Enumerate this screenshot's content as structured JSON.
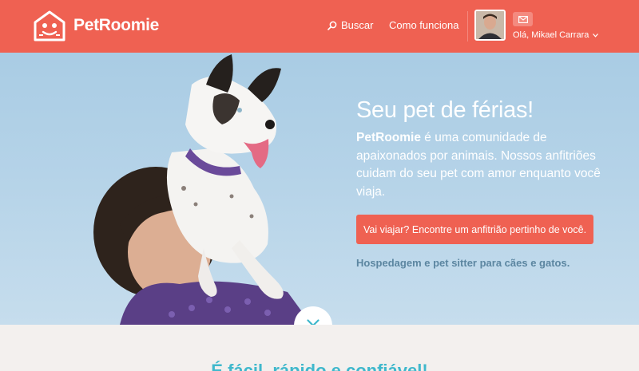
{
  "header": {
    "brand_name": "PetRoomie",
    "nav_search": "Buscar",
    "nav_how": "Como funciona",
    "greeting": "Olá, Mikael Carrara",
    "icons": [
      "logo-icon",
      "search-icon",
      "mail-icon",
      "chevron-down-icon",
      "avatar"
    ]
  },
  "hero": {
    "title": "Seu pet de férias!",
    "body_brand": "PetRoomie",
    "body_rest": " é uma comunidade de apaixonados por animais. Nossos anfitriões cuidam do seu pet com amor enquanto você viaja.",
    "cta_label": "Vai viajar? Encontre um anfitrião pertinho de você.",
    "tagline": "Hospedagem e pet sitter para cães e gatos."
  },
  "section": {
    "title": "É fácil, rápido e confiável!"
  },
  "colors": {
    "brand": "#ef6152",
    "teal": "#3fb8cc",
    "sky": "#b5d3e8",
    "tagline": "#5c86a1"
  }
}
